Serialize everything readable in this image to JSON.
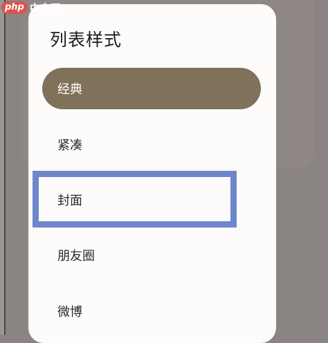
{
  "watermark": {
    "logo": "php",
    "text": "中文网"
  },
  "dialog": {
    "title": "列表样式",
    "options": [
      {
        "label": "经典",
        "selected": true
      },
      {
        "label": "紧凑",
        "selected": false
      },
      {
        "label": "封面",
        "selected": false
      },
      {
        "label": "朋友圈",
        "selected": false
      },
      {
        "label": "微博",
        "selected": false
      }
    ]
  },
  "colors": {
    "selected_fill": "#80725a",
    "highlight_border": "#6d86cc",
    "scrim": "#8a8483",
    "sheet": "#fefbfb"
  }
}
